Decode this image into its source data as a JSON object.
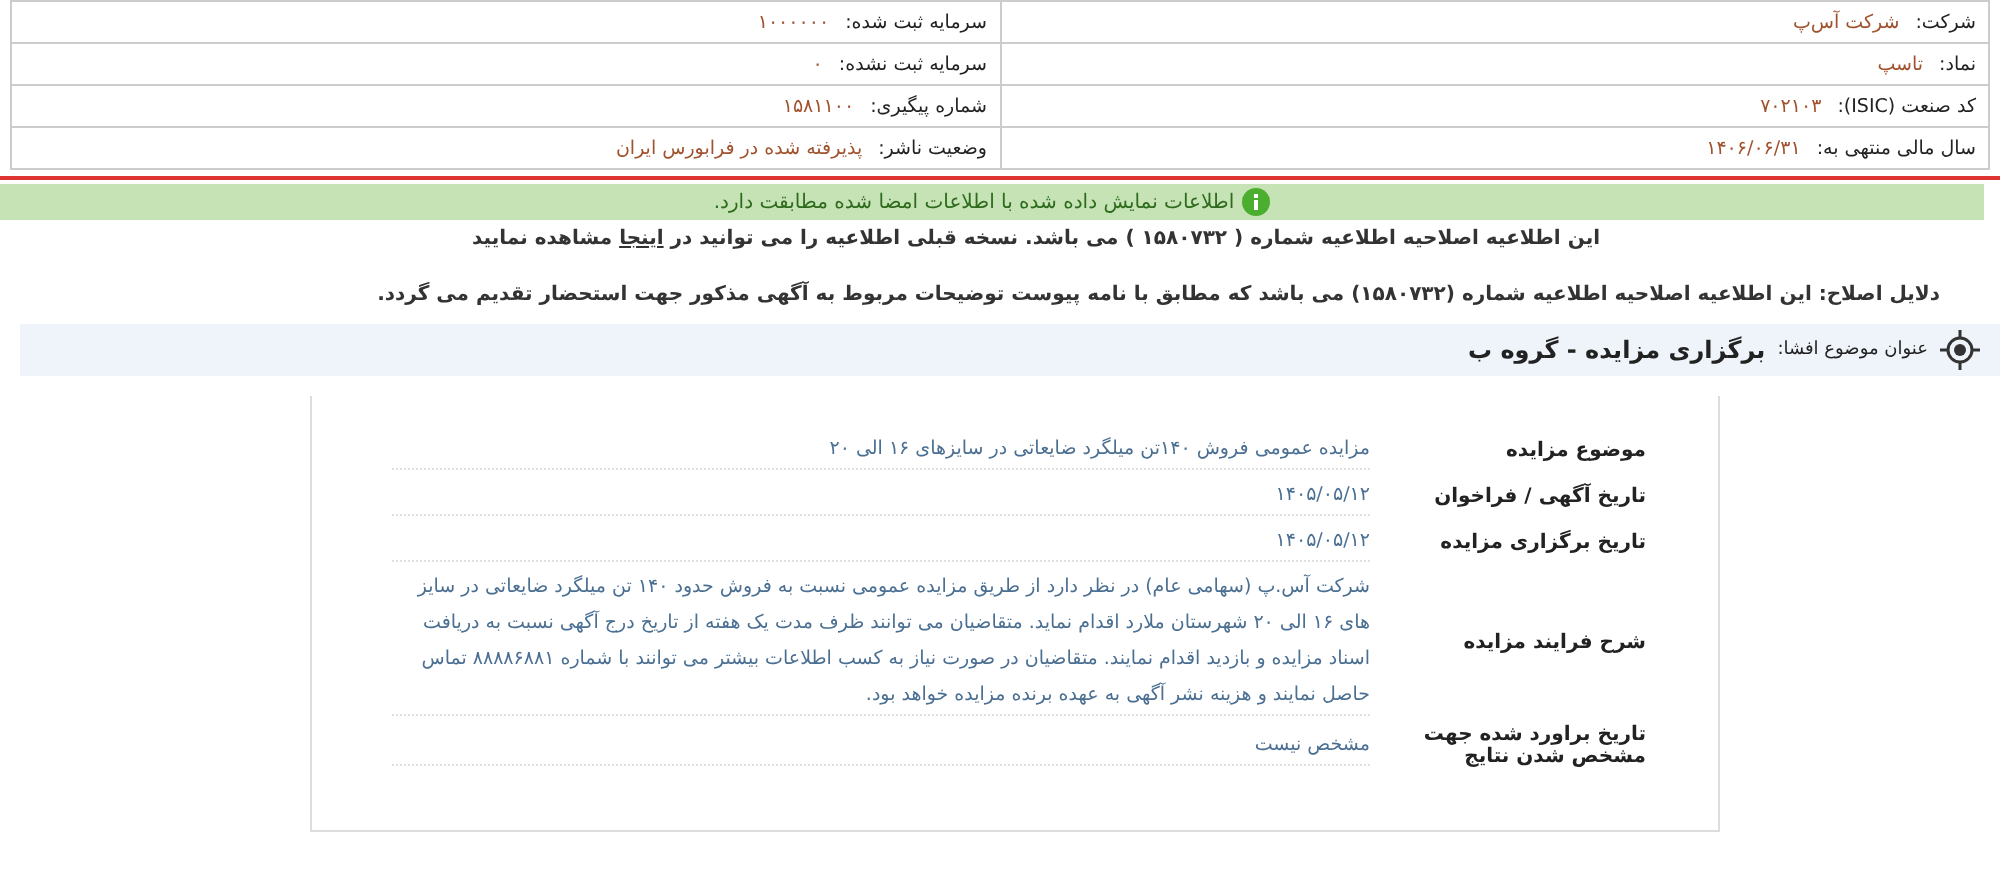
{
  "header": {
    "company_info": [
      {
        "label": "شرکت:",
        "value": "شرکت آس‌پ"
      },
      {
        "label": "نماد:",
        "value": "تاسپ"
      },
      {
        "label": "کد صنعت (ISIC):",
        "value": "۷۰۲۱۰۳"
      },
      {
        "label": "سال مالی منتهی به:",
        "value": "۱۴۰۶/۰۶/۳۱"
      }
    ],
    "capital_info": [
      {
        "label": "سرمایه ثبت شده:",
        "value": "۱۰۰۰۰۰۰"
      },
      {
        "label": "سرمایه ثبت نشده:",
        "value": "۰"
      },
      {
        "label": "شماره پیگیری:",
        "value": "۱۵۸۱۱۰۰"
      },
      {
        "label": "وضعیت ناشر:",
        "value": "پذیرفته شده در فرابورس ایران"
      }
    ]
  },
  "verification_banner": "اطلاعات نمایش داده شده با اطلاعات امضا شده مطابقت دارد.",
  "correction_notice": {
    "before": "این اطلاعیه اصلاحیه اطلاعیه شماره ( ۱۵۸۰۷۳۲ ) می باشد. نسخه قبلی اطلاعیه را می توانید در",
    "link": "اینجا",
    "after": "مشاهده نمایید"
  },
  "correction_reason": "دلایل اصلاح: این اطلاعیه اصلاحیه اطلاعیه شماره (۱۵۸۰۷۳۲) می باشد که مطابق با نامه پیوست توضیحات مربوط به آگهی مذکور جهت استحضار تقدیم می گردد.",
  "subject": {
    "label": "عنوان موضوع افشا:",
    "title": "برگزاری مزایده - گروه ب"
  },
  "details": [
    {
      "label": "موضوع مزایده",
      "value": "مزایده عمومی فروش ۱۴۰تن میلگرد ضایعاتی در سایزهای ۱۶ الی ۲۰"
    },
    {
      "label": "تاریخ آگهی / فراخوان",
      "value": "۱۴۰۵/۰۵/۱۲"
    },
    {
      "label": "تاریخ برگزاری مزایده",
      "value": "۱۴۰۵/۰۵/۱۲"
    },
    {
      "label": "شرح فرایند مزایده",
      "value": "شرکت آس.پ (سهامی عام) در نظر دارد از طریق مزایده عمومی نسبت به فروش حدود ۱۴۰ تن میلگرد ضایعاتی در سایز های ۱۶ الی ۲۰ شهرستان ملارد اقدام نماید. متقاضیان می توانند ظرف مدت یک هفته از تاریخ درج آگهی نسبت به دریافت اسناد مزایده و بازدید اقدام نمایند. متقاضیان در صورت نیاز به کسب اطلاعات بیشتر می توانند با شماره ۸۸۸۸۶۸۸۱ تماس حاصل نمایند و هزینه نشر آگهی به عهده برنده مزایده خواهد بود."
    },
    {
      "label": "تاریخ براورد شده جهت مشخص شدن نتایج",
      "value": "مشخص نیست"
    }
  ]
}
